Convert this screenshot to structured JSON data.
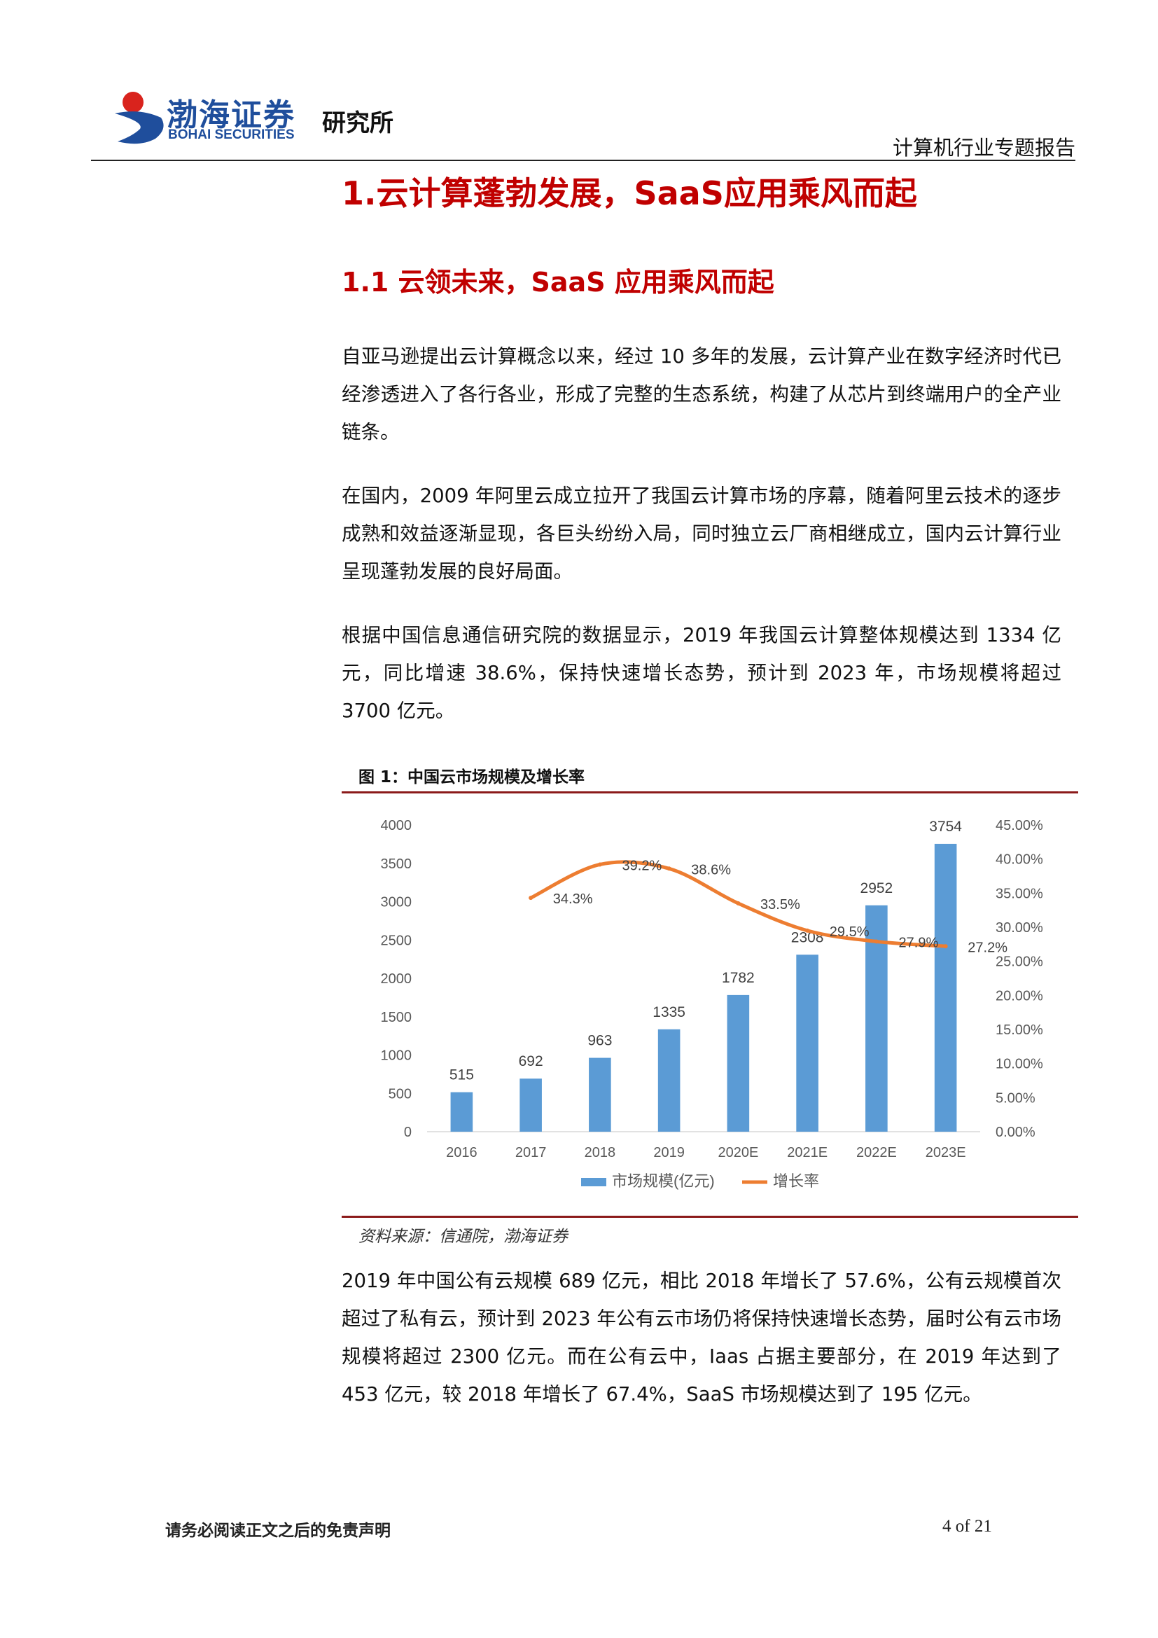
{
  "header": {
    "logo_cn": "渤海证券",
    "logo_en": "BOHAI SECURITIES",
    "dept": "研究所",
    "report_type": "计算机行业专题报告"
  },
  "headings": {
    "h1": "1.云计算蓬勃发展，SaaS应用乘风而起",
    "h2": "1.1 云领未来，SaaS 应用乘风而起"
  },
  "paragraphs": [
    "自亚马逊提出云计算概念以来，经过 10 多年的发展，云计算产业在数字经济时代已经渗透进入了各行各业，形成了完整的生态系统，构建了从芯片到终端用户的全产业链条。",
    "在国内，2009 年阿里云成立拉开了我国云计算市场的序幕，随着阿里云技术的逐步成熟和效益逐渐显现，各巨头纷纷入局，同时独立云厂商相继成立，国内云计算行业呈现蓬勃发展的良好局面。",
    "根据中国信息通信研究院的数据显示，2019 年我国云计算整体规模达到 1334 亿元，同比增速 38.6%，保持快速增长态势，预计到 2023 年，市场规模将超过 3700 亿元。",
    "2019 年中国公有云规模 689 亿元，相比 2018 年增长了 57.6%，公有云规模首次超过了私有云，预计到 2023 年公有云市场仍将保持快速增长态势，届时公有云市场规模将超过 2300 亿元。而在公有云中，Iaas 占据主要部分，在 2019 年达到了 453 亿元，较 2018 年增长了 67.4%，SaaS 市场规模达到了 195 亿元。"
  ],
  "figure": {
    "title": "图 1：中国云市场规模及增长率",
    "source": "资料来源：信通院，渤海证券"
  },
  "chart_data": {
    "type": "bar",
    "categories": [
      "2016",
      "2017",
      "2018",
      "2019",
      "2020E",
      "2021E",
      "2022E",
      "2023E"
    ],
    "series": [
      {
        "name": "市场规模(亿元)",
        "type": "bar",
        "axis": "left",
        "values": [
          515,
          692,
          963,
          1335,
          1782,
          2308,
          2952,
          3754
        ],
        "labels": [
          "515",
          "692",
          "963",
          "1335",
          "1782",
          "2308",
          "2952",
          "3754"
        ],
        "color": "#5b9bd5"
      },
      {
        "name": "增长率",
        "type": "line",
        "axis": "right",
        "values": [
          null,
          34.3,
          39.2,
          38.6,
          33.5,
          29.5,
          27.9,
          27.2
        ],
        "labels": [
          "",
          "34.3%",
          "39.2%",
          "38.6%",
          "33.5%",
          "29.5%",
          "27.9%",
          "27.2%"
        ],
        "color": "#ed7d31"
      }
    ],
    "ylim_left": [
      0,
      4000
    ],
    "yticks_left": [
      "0",
      "500",
      "1000",
      "1500",
      "2000",
      "2500",
      "3000",
      "3500",
      "4000"
    ],
    "ylim_right": [
      0,
      45
    ],
    "yticks_right": [
      "0.00%",
      "5.00%",
      "10.00%",
      "15.00%",
      "20.00%",
      "25.00%",
      "30.00%",
      "35.00%",
      "40.00%",
      "45.00%"
    ],
    "grid": false,
    "legend": "bottom"
  },
  "footer": {
    "disclaimer": "请务必阅读正文之后的免责声明",
    "page": "4 of 21"
  }
}
